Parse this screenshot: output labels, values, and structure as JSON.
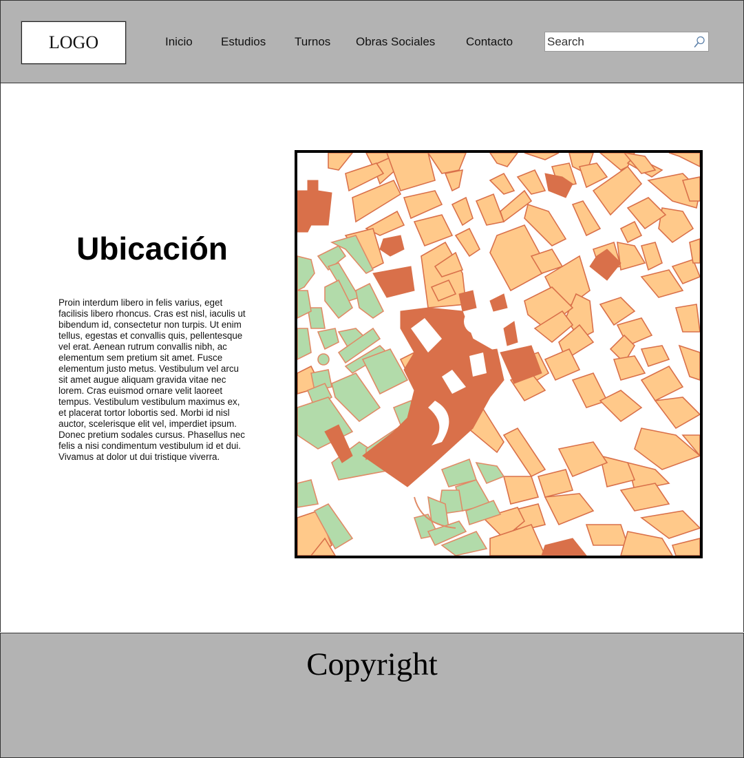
{
  "header": {
    "logo": "LOGO",
    "nav": [
      {
        "label": "Inicio"
      },
      {
        "label": "Estudios"
      },
      {
        "label": "Turnos"
      },
      {
        "label": "Obras Sociales"
      },
      {
        "label": "Contacto"
      }
    ],
    "search": {
      "placeholder": "Search",
      "icon": "search-icon"
    }
  },
  "main": {
    "title": "Ubicación",
    "paragraph": "Proin interdum libero in felis varius, eget facilisis libero rhoncus. Cras est nisl, iaculis ut bibendum id, consectetur non turpis. Ut enim tellus, egestas et convallis quis, pellentesque vel erat. Aenean rutrum convallis nibh, ac elementum sem pretium sit amet. Fusce elementum justo metus. Vestibulum vel arcu sit amet augue aliquam gravida vitae nec lorem. Cras euismod ornare velit laoreet tempus. Vestibulum vestibulum maximus ex, et placerat tortor lobortis sed. Morbi id nisl auctor, scelerisque elit vel, imperdiet ipsum. Donec pretium sodales cursus. Phasellus nec felis a nisi condimentum vestibulum id et dui. Vivamus at dolor ut dui tristique viverra.",
    "map": {
      "colors": {
        "building": "#ffc98a",
        "landmark": "#d9704a",
        "park": "#b2dbaa",
        "outline": "#d9704a",
        "park_outline": "#e08a66",
        "street": "#ffffff"
      }
    }
  },
  "footer": {
    "copyright": "Copyright"
  }
}
